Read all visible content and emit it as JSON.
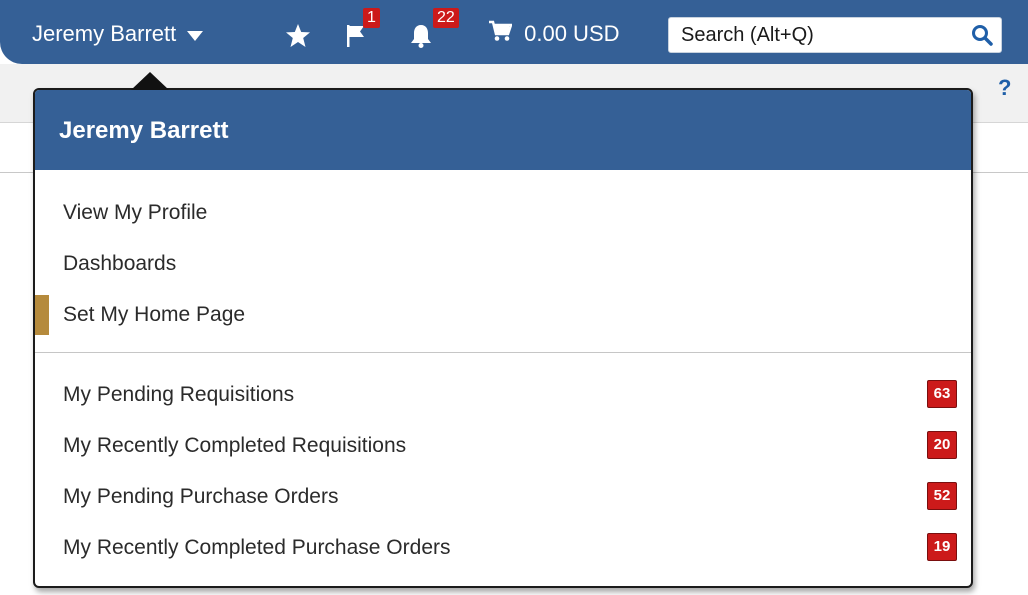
{
  "header": {
    "user_name": "Jeremy Barrett",
    "flag_count": "1",
    "notification_count": "22",
    "cart_total": "0.00 USD",
    "search_placeholder": "Search (Alt+Q)"
  },
  "toolbar": {
    "help": "?"
  },
  "dropdown": {
    "title": "Jeremy Barrett",
    "items": [
      {
        "label": "View My Profile"
      },
      {
        "label": "Dashboards"
      },
      {
        "label": "Set My Home Page",
        "active": true
      }
    ],
    "document_items": [
      {
        "label": "My Pending Requisitions",
        "count": "63"
      },
      {
        "label": "My Recently Completed Requisitions",
        "count": "20"
      },
      {
        "label": "My Pending Purchase Orders",
        "count": "52"
      },
      {
        "label": "My Recently Completed Purchase Orders",
        "count": "19"
      }
    ]
  },
  "colors": {
    "header_blue": "#356096",
    "badge_red": "#cc1a1a",
    "active_indicator": "#b58a3c"
  },
  "icons": [
    "chevron-down-icon",
    "star-icon",
    "flag-icon",
    "bell-icon",
    "cart-icon",
    "search-icon",
    "help-icon"
  ]
}
